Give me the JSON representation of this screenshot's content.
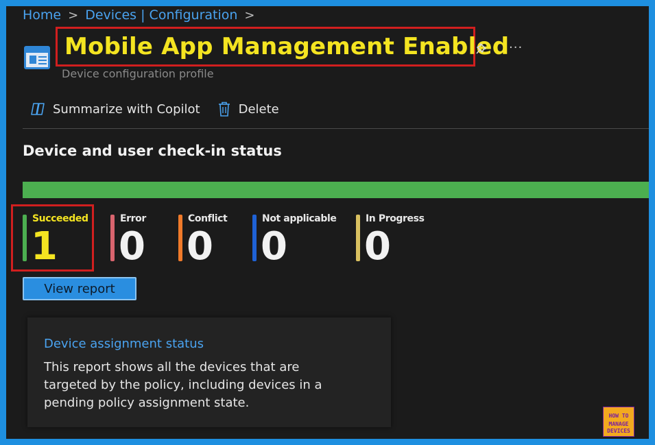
{
  "breadcrumb": {
    "items": [
      "Home",
      "Devices | Configuration"
    ],
    "separator": ">"
  },
  "header": {
    "title": "Mobile App Management Enabled",
    "subtitle": "Device configuration profile",
    "more_label": "···",
    "icons": {
      "page": "configuration-profile-icon",
      "pin": "pin-icon",
      "more": "more-icon"
    }
  },
  "toolbar": {
    "copilot_label": "Summarize with Copilot",
    "delete_label": "Delete"
  },
  "checkin": {
    "title": "Device and user check-in status",
    "bar_color": "#4caf50",
    "stats": [
      {
        "label": "Succeeded",
        "value": "1",
        "color": "#4caf50",
        "label_color": "#f4e421",
        "value_color": "#f4e421"
      },
      {
        "label": "Error",
        "value": "0",
        "color": "#d9646e"
      },
      {
        "label": "Conflict",
        "value": "0",
        "color": "#f07a2a"
      },
      {
        "label": "Not applicable",
        "value": "0",
        "color": "#1f62d6"
      },
      {
        "label": "In Progress",
        "value": "0",
        "color": "#d9c060"
      }
    ],
    "view_report_label": "View report"
  },
  "assignment_card": {
    "title": "Device assignment status",
    "description": "This report shows all the devices that are targeted by the policy, including devices in a pending policy assignment state."
  },
  "watermark": {
    "line1": "HOW TO",
    "line2": "MANAGE",
    "line3": "DEVICES"
  }
}
